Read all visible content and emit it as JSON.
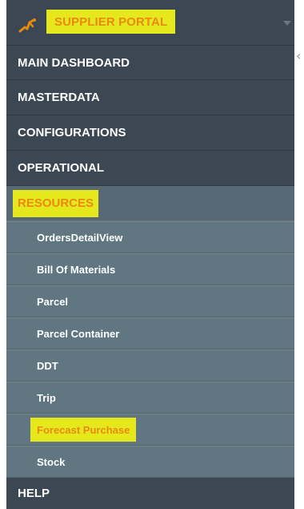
{
  "header": {
    "brand_title": "SUPPLIER PORTAL",
    "logo_icon": "runner-icon",
    "menu_caret_icon": "chevron-down-icon"
  },
  "collapse_icon": "chevron-left-icon",
  "nav": {
    "main_dashboard": "MAIN DASHBOARD",
    "masterdata": "MASTERDATA",
    "configurations": "CONFIGURATIONS",
    "operational": "OPERATIONAL",
    "resources": "RESOURCES",
    "help": "HELP"
  },
  "resources_items": [
    {
      "label": "OrdersDetailView"
    },
    {
      "label": "Bill Of Materials"
    },
    {
      "label": "Parcel"
    },
    {
      "label": "Parcel Container"
    },
    {
      "label": "DDT"
    },
    {
      "label": "Trip"
    },
    {
      "label": "Forecast Purchase"
    },
    {
      "label": "Stock"
    }
  ],
  "colors": {
    "sidebar_bg": "#3b4752",
    "submenu_bg": "#607681",
    "highlight": "#e6e81e",
    "accent_text": "#ea8a0d"
  }
}
